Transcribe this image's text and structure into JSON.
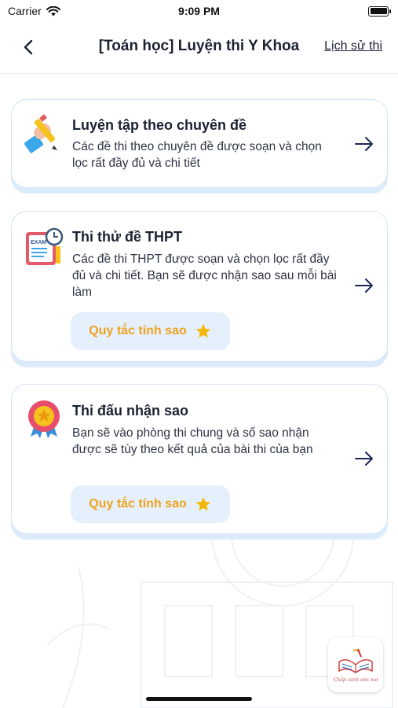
{
  "status_bar": {
    "carrier": "Carrier",
    "time": "9:09 PM"
  },
  "nav": {
    "title": "[Toán học] Luyện thi Y Khoa",
    "history_label": "Lịch sử thi"
  },
  "cards": [
    {
      "title": "Luyện tập theo chuyên đề",
      "description": "Các đề thi theo chuyên đề được soạn và chọn lọc rất đầy đủ và chi tiết",
      "icon": "pencil-hand-icon"
    },
    {
      "title": "Thi thử đề THPT",
      "description": "Các đề thi THPT được soạn và chọn lọc rất đầy đủ và chi tiết. Bạn sẽ được nhận sao sau mỗi bài làm",
      "icon": "exam-paper-icon",
      "icon_text": "EXAM",
      "rule_button": "Quy tắc tính sao"
    },
    {
      "title": "Thi đấu nhận sao",
      "description": "Bạn sẽ vào phòng thi chung và số sao nhận được sẽ tùy theo kết quả của bài thi của bạn",
      "icon": "medal-icon",
      "rule_button": "Quy tắc tính sao"
    }
  ],
  "logo": {
    "text": "Chắp cánh ước mơ"
  },
  "colors": {
    "accent_star": "#f5b800",
    "rule_text": "#f0a21e",
    "card_border": "#d4e5f7"
  }
}
